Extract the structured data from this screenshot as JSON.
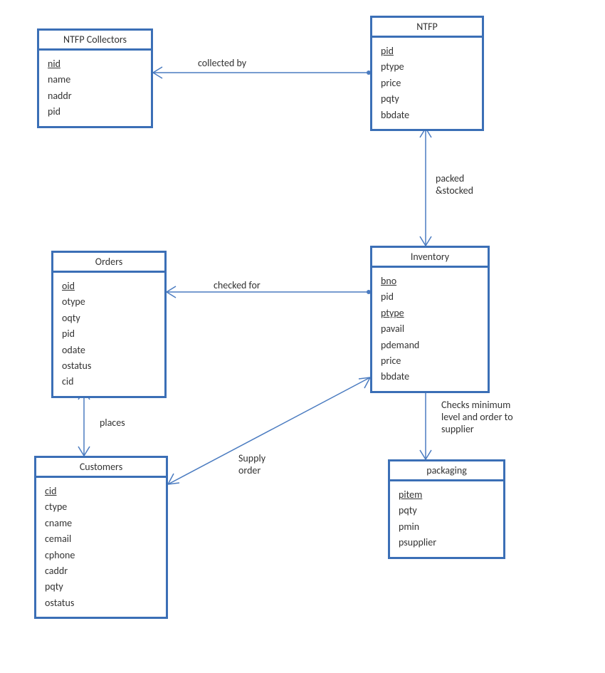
{
  "entities": {
    "ntfp_collectors": {
      "title": "NTFP Collectors",
      "attrs": [
        "nid",
        "name",
        "naddr",
        "pid"
      ],
      "pk": [
        "nid"
      ]
    },
    "ntfp": {
      "title": "NTFP",
      "attrs": [
        "pid",
        "ptype",
        "price",
        "pqty",
        "bbdate"
      ],
      "pk": [
        "pid"
      ]
    },
    "orders": {
      "title": "Orders",
      "attrs": [
        "oid",
        "otype",
        "oqty",
        "pid",
        "odate",
        "ostatus",
        "cid"
      ],
      "pk": [
        "oid"
      ]
    },
    "inventory": {
      "title": "Inventory",
      "attrs": [
        "bno",
        "pid",
        "ptype",
        "pavail",
        "pdemand",
        "price",
        "bbdate"
      ],
      "pk": [
        "bno",
        "ptype"
      ]
    },
    "customers": {
      "title": "Customers",
      "attrs": [
        "cid",
        "ctype",
        "cname",
        "cemail",
        "cphone",
        "caddr",
        "pqty",
        "ostatus"
      ],
      "pk": [
        "cid"
      ]
    },
    "packaging": {
      "title": "packaging",
      "attrs": [
        "pitem",
        "pqty",
        "pmin",
        "psupplier"
      ],
      "pk": [
        "pitem"
      ]
    }
  },
  "relationships": {
    "collected_by": "collected by",
    "packed_stocked": "packed\n&stocked",
    "checked_for": "checked for",
    "places": "places",
    "supply_order": "Supply\norder",
    "checks_min": "Checks minimum\nlevel and order to\nsupplier"
  }
}
